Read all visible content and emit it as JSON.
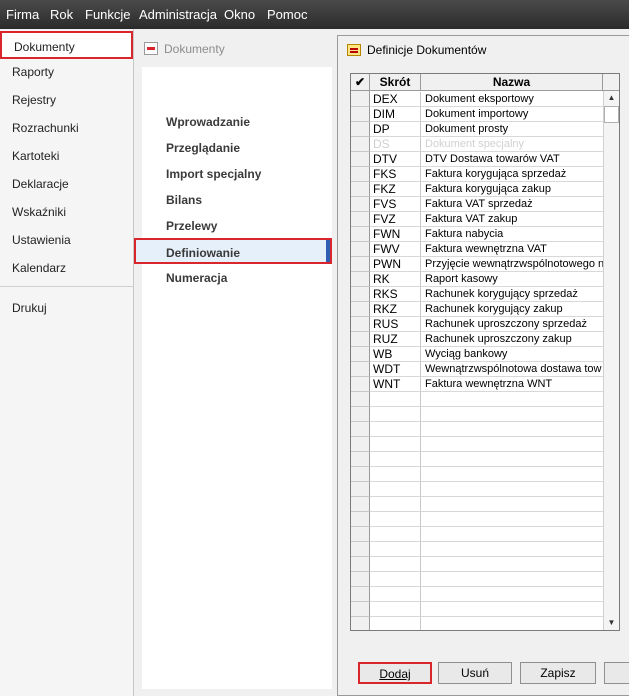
{
  "menu": {
    "items": [
      "Firma",
      "Rok",
      "Funkcje",
      "Administracja",
      "Okno",
      "Pomoc"
    ]
  },
  "sidebar": {
    "items": [
      {
        "label": "Dokumenty",
        "active": true
      },
      {
        "label": "Raporty"
      },
      {
        "label": "Rejestry"
      },
      {
        "label": "Rozrachunki"
      },
      {
        "label": "Kartoteki"
      },
      {
        "label": "Deklaracje"
      },
      {
        "label": "Wskaźniki"
      },
      {
        "label": "Ustawienia"
      },
      {
        "label": "Kalendarz"
      },
      {
        "label": "Drukuj"
      }
    ]
  },
  "module": {
    "title": "Dokumenty",
    "items": [
      {
        "label": "Wprowadzanie"
      },
      {
        "label": "Przeglądanie"
      },
      {
        "label": "Import specjalny"
      },
      {
        "label": "Bilans"
      },
      {
        "label": "Przelewy"
      },
      {
        "label": "Definiowanie",
        "active": true
      },
      {
        "label": "Numeracja"
      }
    ]
  },
  "window": {
    "title": "Definicje Dokumentów",
    "columns": {
      "check": "✔",
      "code": "Skrót",
      "name": "Nazwa"
    },
    "rows": [
      {
        "code": "DEX",
        "name": "Dokument eksportowy"
      },
      {
        "code": "DIM",
        "name": "Dokument importowy"
      },
      {
        "code": "DP",
        "name": "Dokument prosty"
      },
      {
        "code": "DS",
        "name": "Dokument specjalny",
        "faded": true
      },
      {
        "code": "DTV",
        "name": "DTV Dostawa towarów VAT"
      },
      {
        "code": "FKS",
        "name": "Faktura korygująca sprzedaż"
      },
      {
        "code": "FKZ",
        "name": "Faktura korygująca zakup"
      },
      {
        "code": "FVS",
        "name": "Faktura VAT sprzedaż"
      },
      {
        "code": "FVZ",
        "name": "Faktura VAT zakup"
      },
      {
        "code": "FWN",
        "name": "Faktura nabycia"
      },
      {
        "code": "FWV",
        "name": "Faktura wewnętrzna VAT"
      },
      {
        "code": "PWN",
        "name": "Przyjęcie wewnątrzwspólnotowego n"
      },
      {
        "code": "RK",
        "name": "Raport kasowy"
      },
      {
        "code": "RKS",
        "name": "Rachunek korygujący sprzedaż"
      },
      {
        "code": "RKZ",
        "name": "Rachunek korygujący zakup"
      },
      {
        "code": "RUS",
        "name": "Rachunek uproszczony sprzedaż"
      },
      {
        "code": "RUZ",
        "name": "Rachunek uproszczony zakup"
      },
      {
        "code": "WB",
        "name": "Wyciąg bankowy"
      },
      {
        "code": "WDT",
        "name": "Wewnątrzwspólnotowa dostawa tow"
      },
      {
        "code": "WNT",
        "name": "Faktura wewnętrzna WNT"
      }
    ],
    "buttons": {
      "add": "Dodaj",
      "delete": "Usuń",
      "save": "Zapisz"
    }
  },
  "colors": {
    "highlight": "#d9262c",
    "menubar": "#333333",
    "accent": "#2f5fb3"
  }
}
